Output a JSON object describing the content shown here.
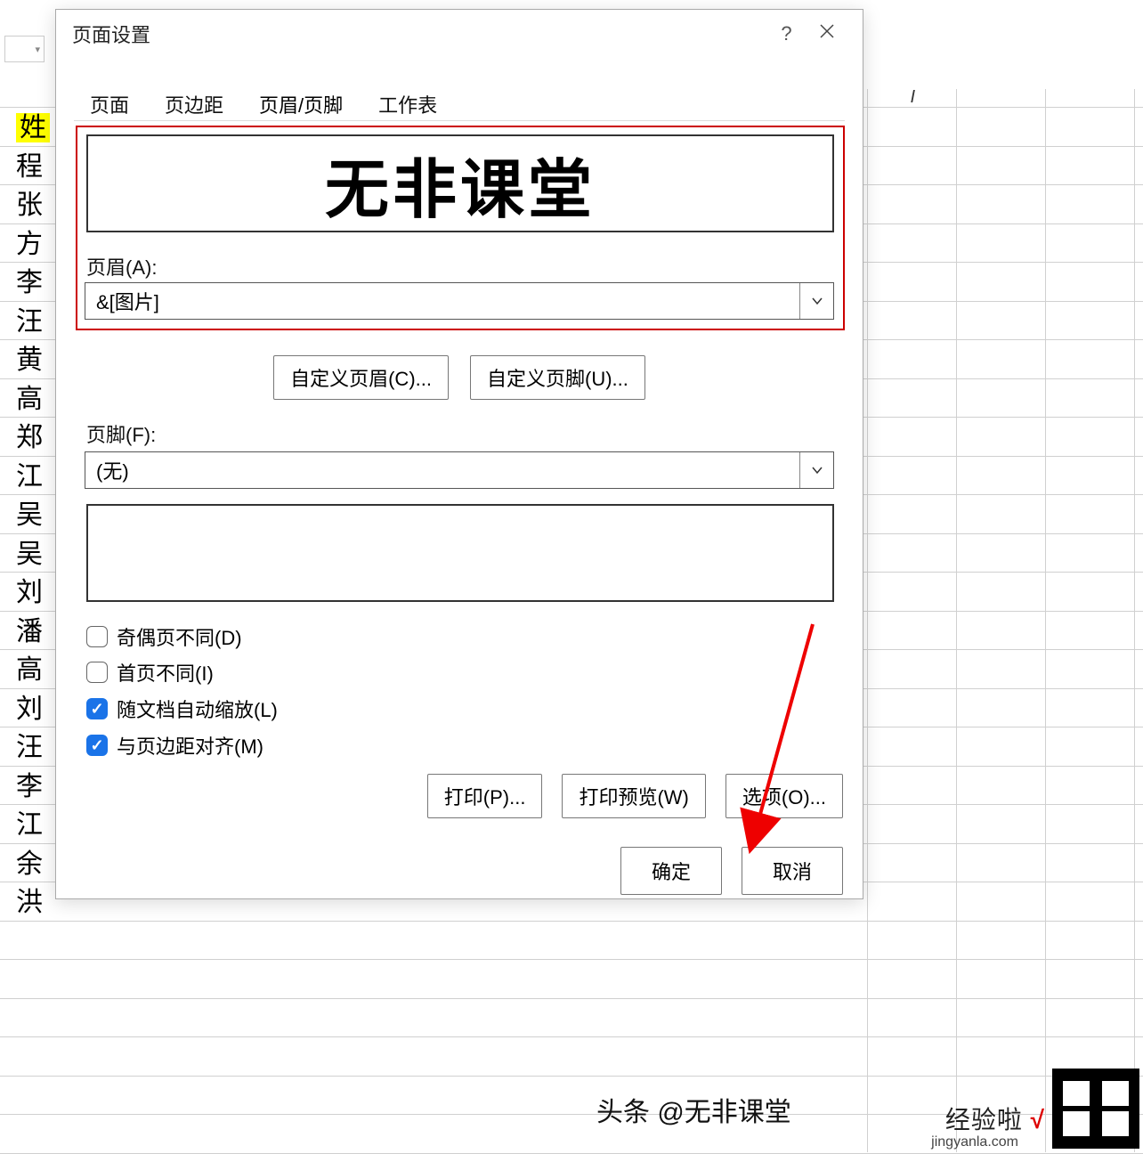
{
  "sheet": {
    "column_letter": "I",
    "row_header": "姓",
    "rows": [
      "程",
      "张",
      "方",
      "李",
      "汪",
      "黄",
      "高",
      "郑",
      "江",
      "吴",
      "吴",
      "刘",
      "潘",
      "高",
      "刘",
      "汪",
      "李",
      "江",
      "余",
      "洪"
    ]
  },
  "dialog": {
    "title": "页面设置",
    "help": "?",
    "tabs": {
      "page": "页面",
      "margins": "页边距",
      "headerfooter": "页眉/页脚",
      "sheet": "工作表"
    },
    "header_preview": "无非课堂",
    "header_label": "页眉(A):",
    "header_value": "&[图片]",
    "custom_header_btn": "自定义页眉(C)...",
    "custom_footer_btn": "自定义页脚(U)...",
    "footer_label": "页脚(F):",
    "footer_value": "(无)",
    "checkboxes": {
      "oddeven": "奇偶页不同(D)",
      "firstpage": "首页不同(I)",
      "scale": "随文档自动缩放(L)",
      "align": "与页边距对齐(M)"
    },
    "print_btn": "打印(P)...",
    "preview_btn": "打印预览(W)",
    "options_btn": "选项(O)...",
    "ok_btn": "确定",
    "cancel_btn": "取消"
  },
  "watermark": {
    "author": "头条 @无非课堂",
    "brand": "经验啦",
    "site": "jingyanla.com"
  }
}
